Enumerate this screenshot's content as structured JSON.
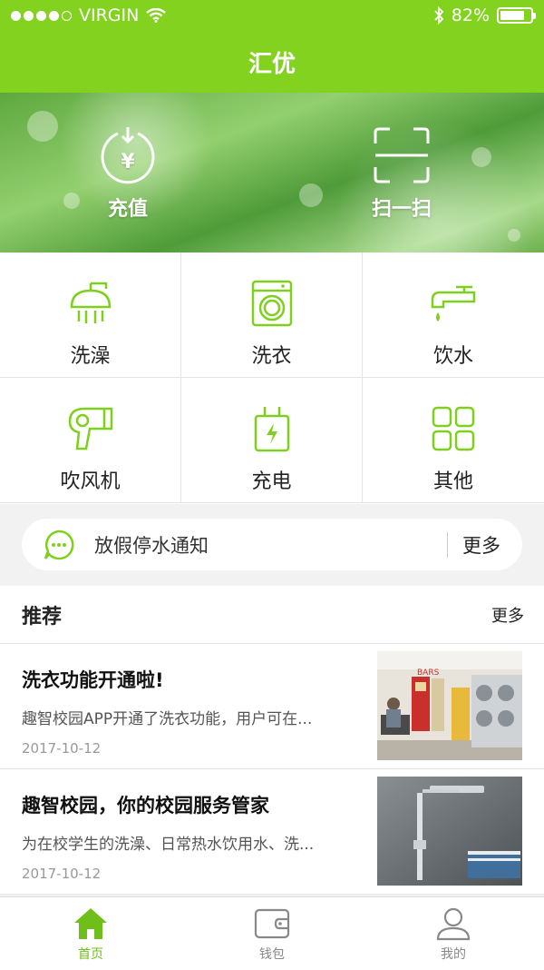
{
  "status": {
    "carrier": "VIRGIN",
    "battery": "82%",
    "battery_level": 0.82
  },
  "nav": {
    "title": "汇优"
  },
  "hero": {
    "recharge_label": "充值",
    "scan_label": "扫一扫"
  },
  "grid": [
    {
      "label": "洗澡",
      "icon": "shower-icon"
    },
    {
      "label": "洗衣",
      "icon": "washing-machine-icon"
    },
    {
      "label": "饮水",
      "icon": "faucet-icon"
    },
    {
      "label": "吹风机",
      "icon": "hair-dryer-icon"
    },
    {
      "label": "充电",
      "icon": "charger-icon"
    },
    {
      "label": "其他",
      "icon": "grid-icon"
    }
  ],
  "notice": {
    "text": "放假停水通知",
    "more": "更多"
  },
  "recommend": {
    "title": "推荐",
    "more": "更多",
    "articles": [
      {
        "title": "洗衣功能开通啦!",
        "desc": "趣智校园APP开通了洗衣功能，用户可在...",
        "date": "2017-10-12"
      },
      {
        "title": "趣智校园，你的校园服务管家",
        "desc": "为在校学生的洗澡、日常热水饮用水、洗...",
        "date": "2017-10-12"
      }
    ]
  },
  "tabs": [
    {
      "label": "首页",
      "icon": "home-icon",
      "active": true
    },
    {
      "label": "钱包",
      "icon": "wallet-icon",
      "active": false
    },
    {
      "label": "我的",
      "icon": "user-icon",
      "active": false
    }
  ],
  "colors": {
    "accent": "#82d21f",
    "active_tab": "#6fbf1a"
  }
}
